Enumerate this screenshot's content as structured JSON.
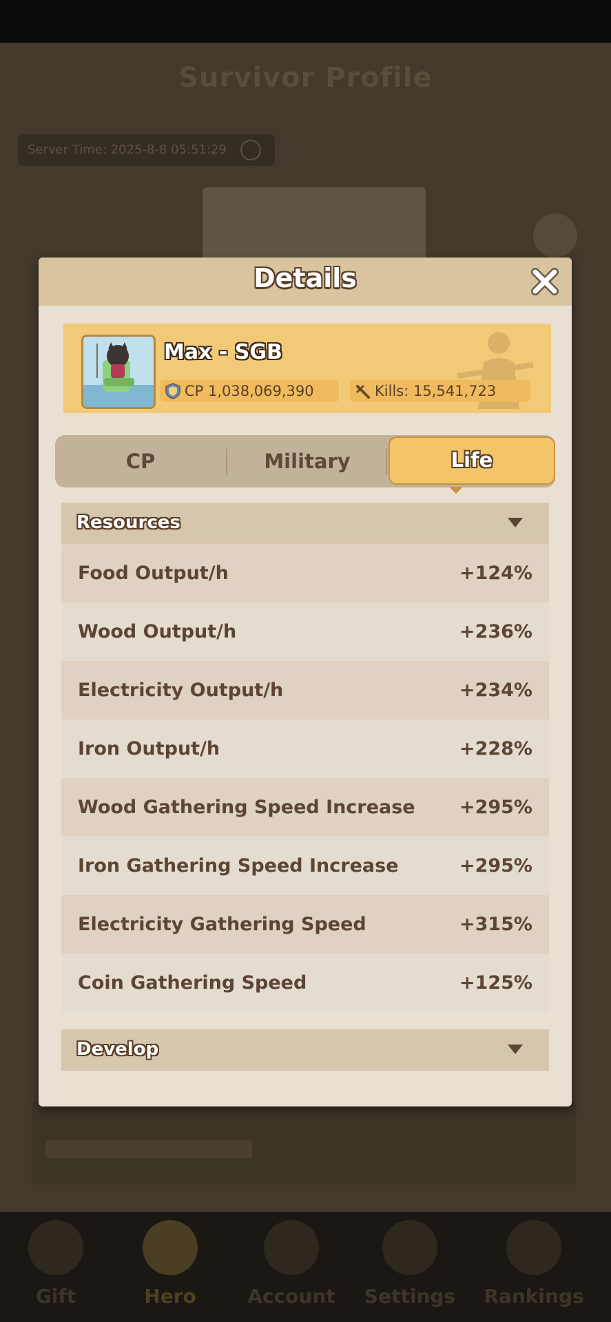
{
  "background": {
    "title": "Survivor Profile",
    "server_time": "Server Time: 2025-8-8 05:51:29",
    "nav": [
      {
        "label": "Gift"
      },
      {
        "label": "Hero"
      },
      {
        "label": "Account"
      },
      {
        "label": "Settings"
      },
      {
        "label": "Rankings"
      }
    ]
  },
  "modal": {
    "title": "Details",
    "player": {
      "name": "Max - SGB",
      "cp": "CP 1,038,069,390",
      "kills": "Kills:  15,541,723"
    },
    "tabs": [
      {
        "label": "CP"
      },
      {
        "label": "Military"
      },
      {
        "label": "Life"
      }
    ],
    "active_tab": "Life",
    "sections": [
      {
        "title": "Resources",
        "expanded": true,
        "rows": [
          {
            "label": "Food Output/h",
            "value": "+124%"
          },
          {
            "label": "Wood Output/h",
            "value": "+236%"
          },
          {
            "label": "Electricity Output/h",
            "value": "+234%"
          },
          {
            "label": "Iron Output/h",
            "value": "+228%"
          },
          {
            "label": "Wood Gathering Speed Increase",
            "value": "+295%"
          },
          {
            "label": "Iron Gathering Speed Increase",
            "value": "+295%"
          },
          {
            "label": "Electricity Gathering Speed",
            "value": "+315%"
          },
          {
            "label": "Coin Gathering Speed",
            "value": "+125%"
          }
        ]
      },
      {
        "title": "Develop",
        "expanded": false
      }
    ]
  },
  "colors": {
    "accent_gold": "#f2ca77",
    "text_brown": "#5c4535",
    "panel_bg": "#e9dfd2"
  }
}
